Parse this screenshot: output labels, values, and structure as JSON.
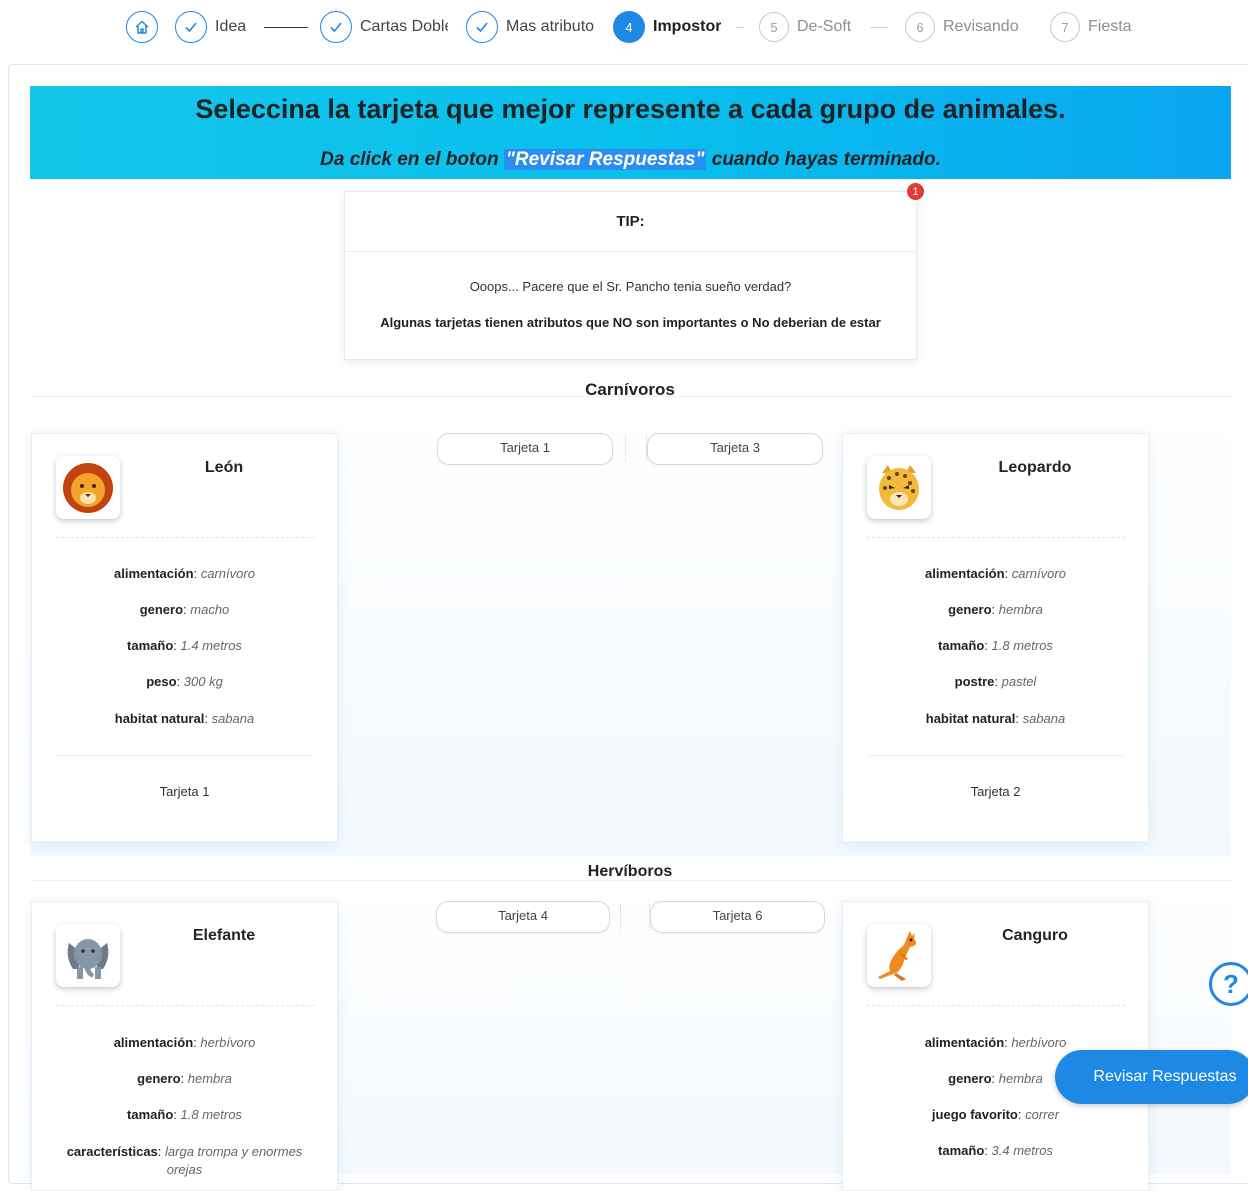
{
  "stepper": {
    "steps": [
      {
        "num": "",
        "label": "Idea",
        "state": "done"
      },
      {
        "num": "",
        "label": "Cartas Doble",
        "state": "done"
      },
      {
        "num": "",
        "label": "Mas atributo",
        "state": "done"
      },
      {
        "num": "4",
        "label": "Impostor",
        "state": "active"
      },
      {
        "num": "5",
        "label": "De-Soft",
        "state": "pending"
      },
      {
        "num": "6",
        "label": "Revisando",
        "state": "pending"
      },
      {
        "num": "7",
        "label": "Fiesta",
        "state": "pending"
      }
    ]
  },
  "banner": {
    "title": "Seleccina la tarjeta que mejor represente a cada grupo de animales.",
    "sub_before": "Da click en el boton ",
    "sub_highlight": "\"Revisar Respuestas\"",
    "sub_after": " cuando hayas terminado."
  },
  "tip": {
    "title": "TIP:",
    "line1": "Ooops... Pacere que el Sr. Pancho tenia sueño verdad?",
    "line2": "Algunas tarjetas tienen atributos que NO son importantes o No deberian de estar",
    "badge": "1"
  },
  "groups": [
    {
      "title": "Carnívoros",
      "slots": [
        "Tarjeta 1",
        "Tarjeta 3"
      ],
      "cards": [
        {
          "name": "León",
          "icon": "lion-icon",
          "footer": "Tarjeta 1",
          "attrs": [
            {
              "k": "alimentación",
              "v": "carnívoro"
            },
            {
              "k": "genero",
              "v": "macho"
            },
            {
              "k": "tamaño",
              "v": "1.4 metros"
            },
            {
              "k": "peso",
              "v": "300 kg"
            },
            {
              "k": "habitat natural",
              "v": "sabana"
            }
          ]
        },
        {
          "name": "Leopardo",
          "icon": "leopard-icon",
          "footer": "Tarjeta 2",
          "attrs": [
            {
              "k": "alimentación",
              "v": "carnívoro"
            },
            {
              "k": "genero",
              "v": "hembra"
            },
            {
              "k": "tamaño",
              "v": "1.8 metros"
            },
            {
              "k": "postre",
              "v": "pastel"
            },
            {
              "k": "habitat natural",
              "v": "sabana"
            }
          ]
        }
      ]
    },
    {
      "title": "Hervíboros",
      "slots": [
        "Tarjeta 4",
        "Tarjeta 6"
      ],
      "cards": [
        {
          "name": "Elefante",
          "icon": "elephant-icon",
          "footer": "",
          "attrs": [
            {
              "k": "alimentación",
              "v": "herbívoro"
            },
            {
              "k": "genero",
              "v": "hembra"
            },
            {
              "k": "tamaño",
              "v": "1.8 metros"
            },
            {
              "k": "características",
              "v": "larga trompa y enormes orejas"
            }
          ]
        },
        {
          "name": "Canguro",
          "icon": "kangaroo-icon",
          "footer": "",
          "attrs": [
            {
              "k": "alimentación",
              "v": "herbívoro"
            },
            {
              "k": "genero",
              "v": "hembra"
            },
            {
              "k": "juego favorito",
              "v": "correr"
            },
            {
              "k": "tamaño",
              "v": "3.4 metros"
            }
          ]
        }
      ]
    }
  ],
  "floating": {
    "help_icon": "question-circle-icon",
    "help_symbol": "?",
    "review_button": "Revisar Respuestas"
  },
  "colors": {
    "accent": "#1e88e5",
    "banner_start": "#15c5ea",
    "banner_end": "#0aa6f0",
    "badge": "#e53935"
  }
}
